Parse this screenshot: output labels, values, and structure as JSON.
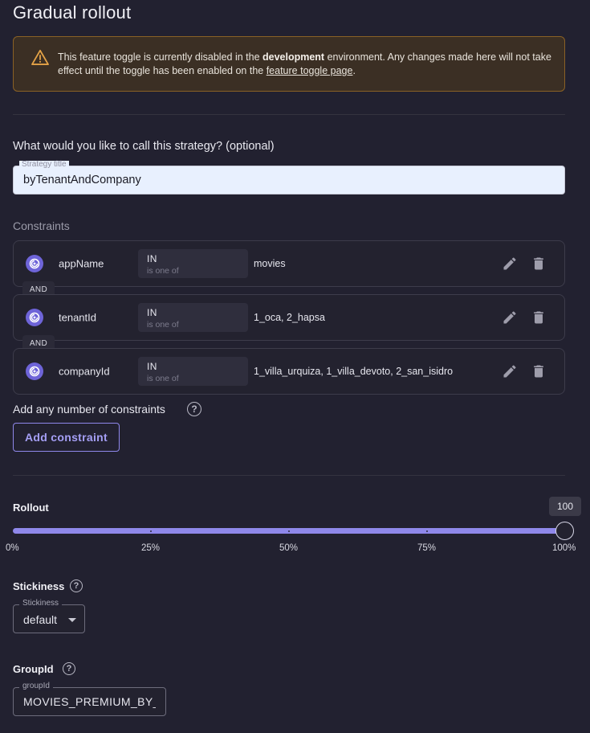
{
  "page": {
    "title": "Gradual rollout"
  },
  "alert": {
    "text_before": "This feature toggle is currently disabled in the ",
    "environment": "development",
    "text_middle": " environment. Any changes made here will not take effect until the toggle has been enabled on the ",
    "link_text": "feature toggle page",
    "text_after": ".",
    "icon": "warning-icon"
  },
  "strategy_title": {
    "question": "What would you like to call this strategy? (optional)",
    "legend": "Strategy title",
    "value": "byTenantAndCompany"
  },
  "constraints": {
    "heading": "Constraints",
    "and_label": "AND",
    "items": [
      {
        "name": "appName",
        "operator": "IN",
        "operator_desc": "is one of",
        "values": "movies"
      },
      {
        "name": "tenantId",
        "operator": "IN",
        "operator_desc": "is one of",
        "values": "1_oca, 2_hapsa"
      },
      {
        "name": "companyId",
        "operator": "IN",
        "operator_desc": "is one of",
        "values": "1_villa_urquiza, 1_villa_devoto, 2_san_isidro"
      }
    ],
    "hint": "Add any number of constraints",
    "add_button": "Add constraint"
  },
  "rollout": {
    "label": "Rollout",
    "value": 100,
    "value_label": "100",
    "ticks": [
      "0%",
      "25%",
      "50%",
      "75%",
      "100%"
    ]
  },
  "stickiness": {
    "label": "Stickiness",
    "legend": "Stickiness",
    "value": "default"
  },
  "group_id": {
    "label": "GroupId",
    "legend": "groupId",
    "value": "MOVIES_PREMIUM_BY_TENANT"
  },
  "colors": {
    "background": "#222130",
    "accent": "#8f88ea",
    "warning_bg": "#3b2f24",
    "warning_border": "#8a6125"
  }
}
